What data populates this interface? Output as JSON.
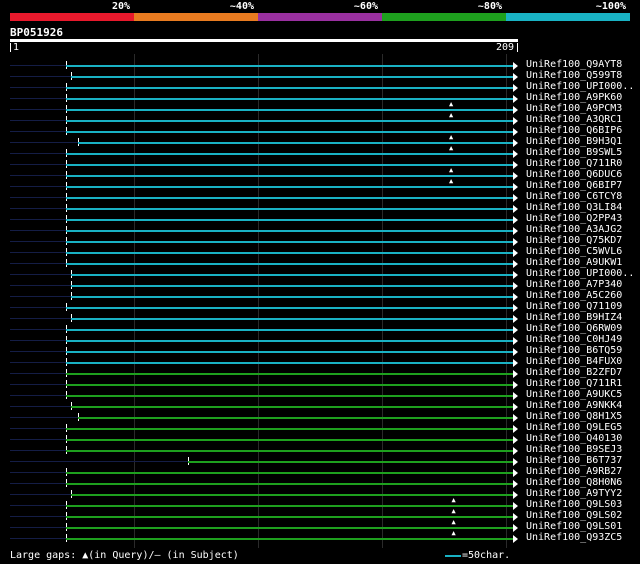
{
  "identity_scale": [
    {
      "label": "20%",
      "color": "#e8192c"
    },
    {
      "label": "~40%",
      "color": "#e87b20"
    },
    {
      "label": "~60%",
      "color": "#9a30a0"
    },
    {
      "label": "~80%",
      "color": "#1ea01e"
    },
    {
      "label": "~100%",
      "color": "#19b2c4"
    }
  ],
  "query": {
    "id": "BP051926",
    "start": "1",
    "end": "209"
  },
  "hits": [
    {
      "name": "UniRef100_Q9AYT8",
      "start": 24,
      "end": 207,
      "color": "#19b2c4",
      "gaps": []
    },
    {
      "name": "UniRef100_Q599T8",
      "start": 26,
      "end": 207,
      "color": "#19b2c4",
      "gaps": []
    },
    {
      "name": "UniRef100_UPI000..",
      "start": 24,
      "end": 207,
      "color": "#19b2c4",
      "gaps": []
    },
    {
      "name": "UniRef100_A9PK60",
      "start": 24,
      "end": 207,
      "color": "#19b2c4",
      "gaps": []
    },
    {
      "name": "UniRef100_A9PCM3",
      "start": 24,
      "end": 207,
      "color": "#19b2c4",
      "gaps": [
        182
      ]
    },
    {
      "name": "UniRef100_A3QRC1",
      "start": 24,
      "end": 207,
      "color": "#19b2c4",
      "gaps": [
        182
      ]
    },
    {
      "name": "UniRef100_Q6BIP6",
      "start": 24,
      "end": 207,
      "color": "#19b2c4",
      "gaps": []
    },
    {
      "name": "UniRef100_B9H3Q1",
      "start": 29,
      "end": 207,
      "color": "#19b2c4",
      "gaps": [
        182
      ]
    },
    {
      "name": "UniRef100_B9SWL5",
      "start": 24,
      "end": 207,
      "color": "#19b2c4",
      "gaps": [
        182
      ]
    },
    {
      "name": "UniRef100_Q711R0",
      "start": 24,
      "end": 207,
      "color": "#19b2c4",
      "gaps": []
    },
    {
      "name": "UniRef100_Q6DUC6",
      "start": 24,
      "end": 207,
      "color": "#19b2c4",
      "gaps": [
        182
      ]
    },
    {
      "name": "UniRef100_Q6BIP7",
      "start": 24,
      "end": 207,
      "color": "#19b2c4",
      "gaps": [
        182
      ]
    },
    {
      "name": "UniRef100_C6TCY8",
      "start": 24,
      "end": 207,
      "color": "#19b2c4",
      "gaps": []
    },
    {
      "name": "UniRef100_Q3LI84",
      "start": 24,
      "end": 207,
      "color": "#19b2c4",
      "gaps": []
    },
    {
      "name": "UniRef100_Q2PP43",
      "start": 24,
      "end": 207,
      "color": "#19b2c4",
      "gaps": []
    },
    {
      "name": "UniRef100_A3AJG2",
      "start": 24,
      "end": 207,
      "color": "#19b2c4",
      "gaps": []
    },
    {
      "name": "UniRef100_Q75KD7",
      "start": 24,
      "end": 207,
      "color": "#19b2c4",
      "gaps": []
    },
    {
      "name": "UniRef100_C5WVL6",
      "start": 24,
      "end": 207,
      "color": "#19b2c4",
      "gaps": []
    },
    {
      "name": "UniRef100_A9UKW1",
      "start": 24,
      "end": 207,
      "color": "#19b2c4",
      "gaps": []
    },
    {
      "name": "UniRef100_UPI000..",
      "start": 26,
      "end": 207,
      "color": "#19b2c4",
      "gaps": []
    },
    {
      "name": "UniRef100_A7P340",
      "start": 26,
      "end": 207,
      "color": "#19b2c4",
      "gaps": []
    },
    {
      "name": "UniRef100_A5C260",
      "start": 26,
      "end": 207,
      "color": "#19b2c4",
      "gaps": []
    },
    {
      "name": "UniRef100_Q71109",
      "start": 24,
      "end": 207,
      "color": "#19b2c4",
      "gaps": []
    },
    {
      "name": "UniRef100_B9HIZ4",
      "start": 26,
      "end": 207,
      "color": "#19b2c4",
      "gaps": []
    },
    {
      "name": "UniRef100_Q6RW09",
      "start": 24,
      "end": 207,
      "color": "#19b2c4",
      "gaps": []
    },
    {
      "name": "UniRef100_C0HJ49",
      "start": 24,
      "end": 207,
      "color": "#19b2c4",
      "gaps": []
    },
    {
      "name": "UniRef100_B6TQ59",
      "start": 24,
      "end": 207,
      "color": "#19b2c4",
      "gaps": []
    },
    {
      "name": "UniRef100_B4FUX0",
      "start": 24,
      "end": 207,
      "color": "#19b2c4",
      "gaps": []
    },
    {
      "name": "UniRef100_B2ZFD7",
      "start": 24,
      "end": 207,
      "color": "#1ea01e",
      "gaps": []
    },
    {
      "name": "UniRef100_Q711R1",
      "start": 24,
      "end": 207,
      "color": "#1ea01e",
      "gaps": []
    },
    {
      "name": "UniRef100_A9UKC5",
      "start": 24,
      "end": 207,
      "color": "#1ea01e",
      "gaps": []
    },
    {
      "name": "UniRef100_A9NKK4",
      "start": 26,
      "end": 207,
      "color": "#1ea01e",
      "gaps": []
    },
    {
      "name": "UniRef100_Q8H1X5",
      "start": 29,
      "end": 207,
      "color": "#1ea01e",
      "gaps": []
    },
    {
      "name": "UniRef100_Q9LEG5",
      "start": 24,
      "end": 207,
      "color": "#1ea01e",
      "gaps": []
    },
    {
      "name": "UniRef100_Q40130",
      "start": 24,
      "end": 207,
      "color": "#1ea01e",
      "gaps": []
    },
    {
      "name": "UniRef100_B9SEJ3",
      "start": 24,
      "end": 207,
      "color": "#1ea01e",
      "gaps": []
    },
    {
      "name": "UniRef100_B6T737",
      "start": 74,
      "end": 207,
      "color": "#1ea01e",
      "gaps": []
    },
    {
      "name": "UniRef100_A9RB27",
      "start": 24,
      "end": 207,
      "color": "#1ea01e",
      "gaps": []
    },
    {
      "name": "UniRef100_Q8H0N6",
      "start": 24,
      "end": 207,
      "color": "#1ea01e",
      "gaps": []
    },
    {
      "name": "UniRef100_A9TYY2",
      "start": 26,
      "end": 207,
      "color": "#1ea01e",
      "gaps": []
    },
    {
      "name": "UniRef100_Q9LS03",
      "start": 24,
      "end": 207,
      "color": "#1ea01e",
      "gaps": [
        183
      ]
    },
    {
      "name": "UniRef100_Q9LS02",
      "start": 24,
      "end": 207,
      "color": "#1ea01e",
      "gaps": [
        183
      ]
    },
    {
      "name": "UniRef100_Q9LS01",
      "start": 24,
      "end": 207,
      "color": "#1ea01e",
      "gaps": [
        183
      ]
    },
    {
      "name": "UniRef100_Q93ZC5",
      "start": 24,
      "end": 207,
      "color": "#1ea01e",
      "gaps": [
        183
      ]
    }
  ],
  "footer": {
    "legend": "Large gaps: ▲(in Query)/– (in Subject)",
    "scale_label": "=50char."
  }
}
